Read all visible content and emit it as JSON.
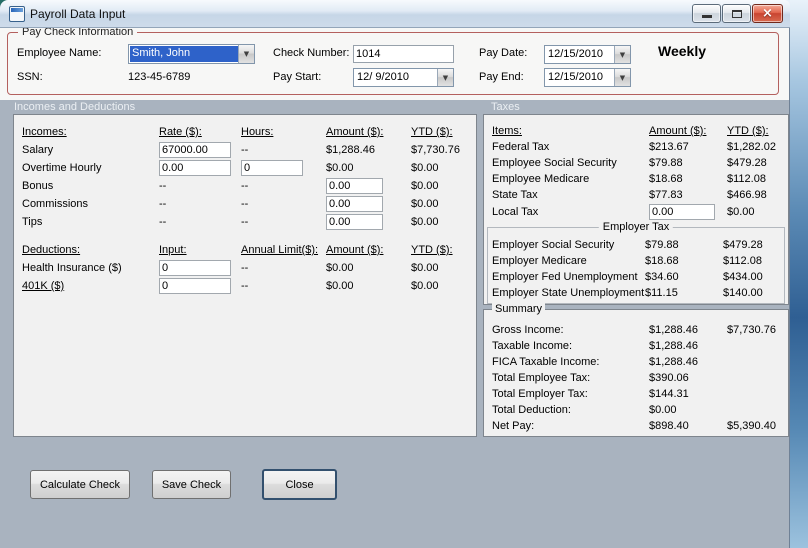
{
  "window": {
    "title": "Payroll Data Input"
  },
  "icons": {
    "dropdown_arrow": "▼",
    "close": "×"
  },
  "paycheck": {
    "group_title": "Pay Check Information",
    "employee_name": {
      "label": "Employee Name:",
      "value": "Smith, John"
    },
    "ssn": {
      "label": "SSN:",
      "value": "123-45-6789"
    },
    "check_number": {
      "label": "Check Number:",
      "value": "1014"
    },
    "pay_start": {
      "label": "Pay Start:",
      "value": "12/ 9/2010"
    },
    "pay_date": {
      "label": "Pay Date:",
      "value": "12/15/2010"
    },
    "pay_end": {
      "label": "Pay End:",
      "value": "12/15/2010"
    },
    "frequency": "Weekly"
  },
  "sections": {
    "incomes": "Incomes and Deductions",
    "taxes": "Taxes"
  },
  "incomes": {
    "headers": {
      "item": "Incomes:",
      "rate": "Rate ($):",
      "hours": "Hours:",
      "amount": "Amount ($):",
      "ytd": "YTD ($):"
    },
    "rows": [
      {
        "label": "Salary",
        "rate": "67000.00",
        "hours": "--",
        "amount": "$1,288.46",
        "ytd": "$7,730.76"
      },
      {
        "label": "Overtime Hourly",
        "rate": "0.00",
        "hours": "0",
        "amount": "$0.00",
        "ytd": "$0.00"
      },
      {
        "label": "Bonus",
        "rate": "--",
        "hours": "--",
        "amount": "0.00",
        "ytd": "$0.00"
      },
      {
        "label": "Commissions",
        "rate": "--",
        "hours": "--",
        "amount": "0.00",
        "ytd": "$0.00"
      },
      {
        "label": "Tips",
        "rate": "--",
        "hours": "--",
        "amount": "0.00",
        "ytd": "$0.00"
      }
    ]
  },
  "deductions": {
    "headers": {
      "item": "Deductions:",
      "input": "Input:",
      "limit": "Annual Limit($):",
      "amount": "Amount ($):",
      "ytd": "YTD ($):"
    },
    "rows": [
      {
        "label": "Health Insurance ($)",
        "input": "0",
        "limit": "--",
        "amount": "$0.00",
        "ytd": "$0.00"
      },
      {
        "label": "401K ($)",
        "input": "0",
        "limit": "--",
        "amount": "$0.00",
        "ytd": "$0.00"
      }
    ]
  },
  "taxes": {
    "headers": {
      "item": "Items:",
      "amount": "Amount ($):",
      "ytd": "YTD ($):"
    },
    "employee_rows": [
      {
        "label": "Federal Tax",
        "amount": "$213.67",
        "ytd": "$1,282.02"
      },
      {
        "label": "Employee Social Security",
        "amount": "$79.88",
        "ytd": "$479.28"
      },
      {
        "label": "Employee Medicare",
        "amount": "$18.68",
        "ytd": "$112.08"
      },
      {
        "label": "State Tax",
        "amount": "$77.83",
        "ytd": "$466.98"
      },
      {
        "label": "Local Tax",
        "amount": "0.00",
        "ytd": "$0.00"
      }
    ],
    "employer_group_title": "Employer Tax",
    "employer_rows": [
      {
        "label": "Employer Social Security",
        "amount": "$79.88",
        "ytd": "$479.28"
      },
      {
        "label": "Employer Medicare",
        "amount": "$18.68",
        "ytd": "$112.08"
      },
      {
        "label": "Employer Fed Unemployment",
        "amount": "$34.60",
        "ytd": "$434.00"
      },
      {
        "label": "Employer State Unemployment",
        "amount": "$11.15",
        "ytd": "$140.00"
      }
    ]
  },
  "summary": {
    "group_title": "Summary",
    "rows": [
      {
        "label": "Gross Income:",
        "amount": "$1,288.46",
        "ytd": "$7,730.76"
      },
      {
        "label": "Taxable Income:",
        "amount": "$1,288.46",
        "ytd": ""
      },
      {
        "label": "FICA Taxable Income:",
        "amount": "$1,288.46",
        "ytd": ""
      },
      {
        "label": "Total Employee Tax:",
        "amount": "$390.06",
        "ytd": ""
      },
      {
        "label": "Total Employer Tax:",
        "amount": "$144.31",
        "ytd": ""
      },
      {
        "label": "Total Deduction:",
        "amount": "$0.00",
        "ytd": ""
      },
      {
        "label": "Net Pay:",
        "amount": "$898.40",
        "ytd": "$5,390.40"
      }
    ]
  },
  "buttons": {
    "calculate": "Calculate Check",
    "save": "Save Check",
    "close": "Close"
  },
  "colors": {
    "form_background": "#a9b3bf",
    "paycheck_border": "#b4605e",
    "selection_blue": "#2e62c9",
    "close_button_red": "#c84430",
    "panel_background": "#f1f1f1"
  }
}
